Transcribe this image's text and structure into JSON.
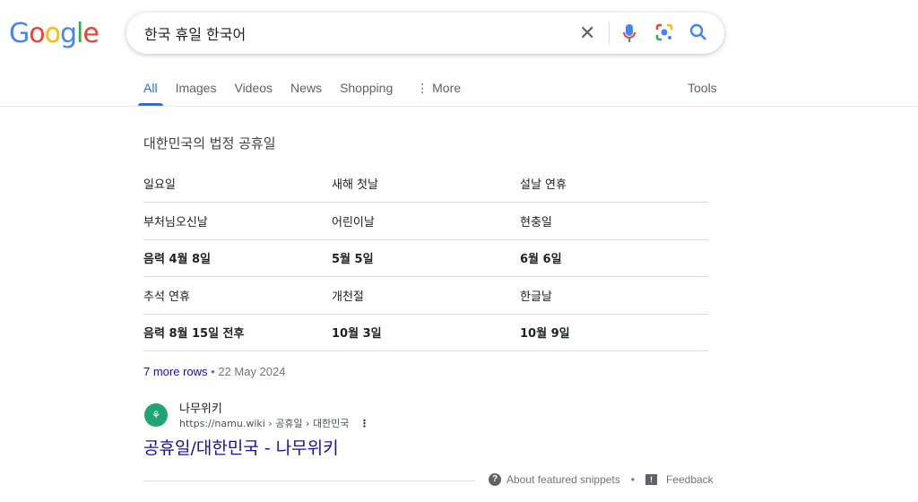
{
  "header": {
    "logo": "Google",
    "query": "한국 휴일 한국어",
    "icons": [
      "close-icon",
      "mic-icon",
      "lens-icon",
      "search-icon"
    ]
  },
  "tabs": [
    {
      "label": "All",
      "active": true
    },
    {
      "label": "Images"
    },
    {
      "label": "Videos"
    },
    {
      "label": "News"
    },
    {
      "label": "Shopping"
    },
    {
      "label": "⋮ More"
    }
  ],
  "tools": "Tools",
  "snippet": {
    "title": "대한민국의 법정 공휴일",
    "rows": [
      [
        "일요일",
        "새해 첫날",
        "설날 연휴"
      ],
      [
        "부처님오신날",
        "어린이날",
        "현충일"
      ],
      [
        "음력 4월 8일",
        "5월 5일",
        "6월 6일"
      ],
      [
        "추석 연휴",
        "개천절",
        "한글날"
      ],
      [
        "음력 8월 15일 전후",
        "10월 3일",
        "10월 9일"
      ]
    ],
    "more_rows": "7 more rows",
    "date": "22 May 2024"
  },
  "result": {
    "site": "나무위키",
    "url": "https://namu.wiki › 공휴일 › 대한민국",
    "title": "공휴일/대한민국 - 나무위키"
  },
  "footer": {
    "about": "About featured snippets",
    "feedback": "Feedback"
  }
}
